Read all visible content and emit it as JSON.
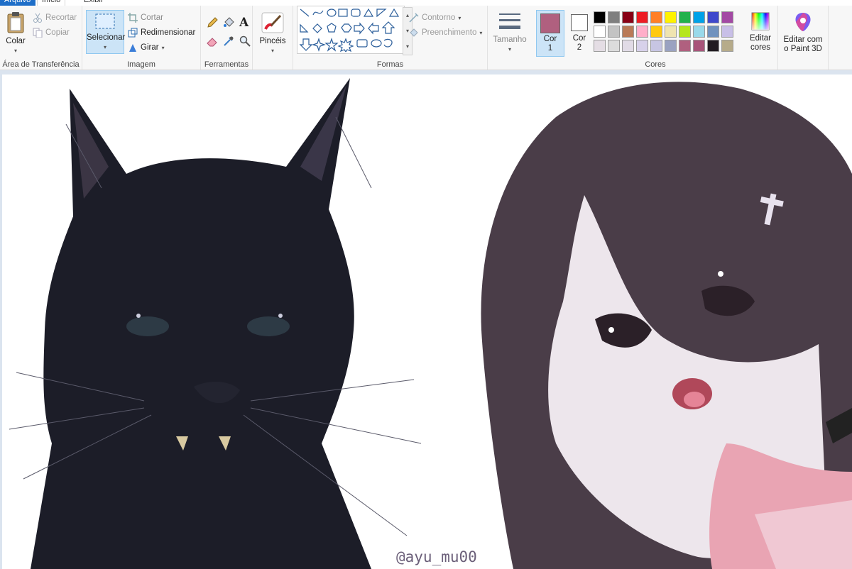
{
  "tabs": {
    "file": "Arquivo",
    "home": "Início",
    "view": "Exibir"
  },
  "clipboard": {
    "paste": "Colar",
    "cut": "Recortar",
    "copy": "Copiar",
    "label": "Área de Transferência"
  },
  "image": {
    "select": "Selecionar",
    "crop": "Cortar",
    "resize": "Redimensionar",
    "rotate": "Girar",
    "label": "Imagem"
  },
  "tools": {
    "label": "Ferramentas"
  },
  "brushes": {
    "label": "Pincéis"
  },
  "shapes": {
    "outline": "Contorno",
    "fill": "Preenchimento",
    "label": "Formas"
  },
  "size": {
    "label": "Tamanho"
  },
  "colors": {
    "color1": "Cor 1",
    "color2": "Cor 2",
    "edit": "Editar cores",
    "label": "Cores",
    "color1_value": "#b0607f",
    "color2_value": "#ffffff",
    "palette": [
      "#000000",
      "#7f7f7f",
      "#880015",
      "#ed1c24",
      "#ff7f27",
      "#fff200",
      "#22b14c",
      "#00a2e8",
      "#3f48cc",
      "#a349a4",
      "#ffffff",
      "#c3c3c3",
      "#b97a57",
      "#ffaec9",
      "#ffc90e",
      "#efe4b0",
      "#b5e61d",
      "#99d9ea",
      "#7092be",
      "#c8bfe7",
      "#e4dde4",
      "#dcdcdc",
      "#e1dbe6",
      "#d7d1ea",
      "#c7c5e3",
      "#9aa2c1",
      "#b0607f",
      "#a8557a",
      "#221c22",
      "#b6ab8a"
    ]
  },
  "paint3d": {
    "label": "Editar com o Paint 3D"
  },
  "canvas": {
    "watermark": "@ayu_mu00"
  }
}
